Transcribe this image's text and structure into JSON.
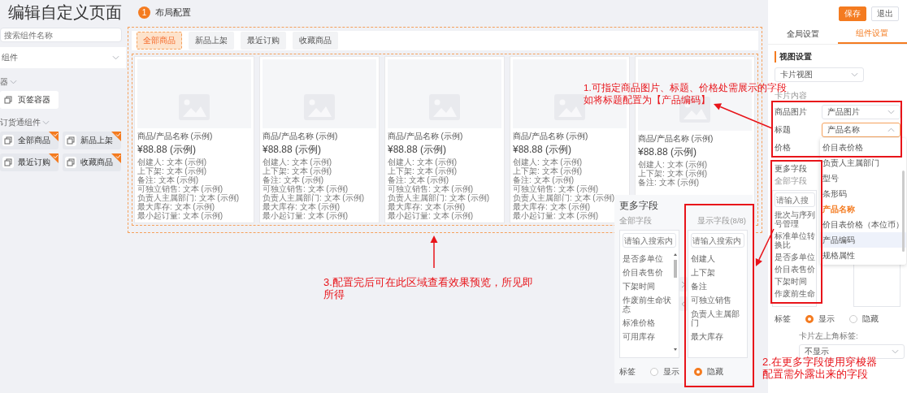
{
  "header": {
    "title": "编辑自定义页面",
    "step": {
      "number": "1",
      "label": "布局配置"
    }
  },
  "sidebar": {
    "search": {
      "placeholder": "搜索组件名称"
    },
    "panel_title": "组件",
    "groups": [
      {
        "title": "器",
        "items": [
          {
            "label": "页签容器",
            "added": false
          }
        ]
      },
      {
        "title": "订货通组件",
        "items": [
          {
            "label": "全部商品",
            "added": true
          },
          {
            "label": "新品上架",
            "added": true
          },
          {
            "label": "最近订购",
            "added": true
          },
          {
            "label": "收藏商品",
            "added": true
          }
        ]
      }
    ]
  },
  "preview": {
    "tabs": [
      {
        "label": "全部商品",
        "selected": true
      },
      {
        "label": "新品上架",
        "selected": false
      },
      {
        "label": "最近订购",
        "selected": false
      },
      {
        "label": "收藏商品",
        "selected": false
      }
    ],
    "cards": [
      {
        "title": "商品/产品名称 (示例)",
        "price": "¥88.88 (示例)",
        "fields": [
          "创建人: 文本 (示例)",
          "上下架: 文本 (示例)",
          "备注: 文本 (示例)",
          "可独立销售: 文本 (示例)",
          "负责人主属部门: 文本 (示例)",
          "最大库存: 文本 (示例)",
          "最小起订量: 文本 (示例)"
        ]
      },
      {
        "title": "商品/产品名称 (示例)",
        "price": "¥88.88 (示例)",
        "fields": [
          "创建人: 文本 (示例)",
          "上下架: 文本 (示例)",
          "备注: 文本 (示例)",
          "可独立销售: 文本 (示例)",
          "负责人主属部门: 文本 (示例)",
          "最大库存: 文本 (示例)",
          "最小起订量: 文本 (示例)"
        ]
      },
      {
        "title": "商品/产品名称 (示例)",
        "price": "¥88.88 (示例)",
        "fields": [
          "创建人: 文本 (示例)",
          "上下架: 文本 (示例)",
          "备注: 文本 (示例)",
          "可独立销售: 文本 (示例)",
          "负责人主属部门: 文本 (示例)",
          "最大库存: 文本 (示例)",
          "最小起订量: 文本 (示例)"
        ]
      },
      {
        "title": "商品/产品名称 (示例)",
        "price": "¥88.88 (示例)",
        "fields": [
          "创建人: 文本 (示例)",
          "上下架: 文本 (示例)",
          "备注: 文本 (示例)",
          "可独立销售: 文本 (示例)",
          "负责人主属部门: 文本 (示例)",
          "最大库存: 文本 (示例)",
          "最小起订量: 文本 (示例)"
        ]
      },
      {
        "title": "商品/产品名称 (示例)",
        "price": "¥88.88 (示例)",
        "fields": [
          "创建人: 文本 (示例)",
          "上下架: 文本 (示例)",
          "备注: 文本 (示例)"
        ]
      }
    ]
  },
  "field_picker": {
    "title": "更多字段",
    "source_label": "全部字段",
    "target_label": "显示字段(8/8)",
    "source": {
      "placeholder": "请输入搜索内",
      "items": [
        "是否多单位",
        "价目表售价",
        "下架时间",
        "作废前生命状态",
        "标准价格",
        "可用库存"
      ]
    },
    "target": {
      "placeholder": "请输入搜索内",
      "items": [
        "创建人",
        "上下架",
        "备注",
        "可独立销售",
        "负责人主属部门",
        "最大库存"
      ]
    },
    "tag": {
      "label": "标签",
      "options": [
        {
          "label": "显示",
          "selected": false
        },
        {
          "label": "隐藏",
          "selected": true
        }
      ]
    }
  },
  "settings": {
    "buttons": [
      {
        "label": "保存",
        "kind": "primary"
      },
      {
        "label": "退出",
        "kind": "default"
      }
    ],
    "tabs": [
      {
        "label": "全局设置",
        "selected": false
      },
      {
        "label": "组件设置",
        "selected": true
      }
    ],
    "section_title": "视图设置",
    "view": "卡片视图",
    "content_label": "卡片内容",
    "rows": [
      {
        "label": "商品图片",
        "value": "产品图片",
        "open": false
      },
      {
        "label": "标题",
        "value": "产品名称",
        "open": true
      },
      {
        "label": "价格"
      }
    ],
    "dropdown": [
      {
        "label": "价目表价格",
        "selected": false,
        "highlighted": false
      },
      {
        "label": "负责人主属部门",
        "selected": false,
        "highlighted": false
      },
      {
        "label": "型号",
        "selected": false,
        "highlighted": false
      },
      {
        "label": "条形码",
        "selected": false,
        "highlighted": false
      },
      {
        "label": "产品名称",
        "selected": true,
        "highlighted": false
      },
      {
        "label": "价目表价格（本位币）",
        "selected": false,
        "highlighted": false
      },
      {
        "label": "产品编码",
        "selected": false,
        "highlighted": true
      },
      {
        "label": "规格属性",
        "selected": false,
        "highlighted": false
      }
    ],
    "more_fields": {
      "title": "更多字段",
      "source_label": "全部字段",
      "placeholder": "请输入搜",
      "items": [
        "批次与序列号管理",
        "标准单位转换比",
        "是否多单位",
        "价目表售价",
        "下架时间",
        "作废前生命"
      ]
    },
    "tag": {
      "label": "标签",
      "options": [
        {
          "label": "显示",
          "selected": true
        },
        {
          "label": "隐藏",
          "selected": false
        }
      ]
    },
    "corner_label": "卡片左上角标签:",
    "corner_value": "不显示"
  },
  "annotations": [
    {
      "lines": [
        "1.可指定商品图片、标题、价格处需展示的字段",
        "如将标题配置为【产品编码】"
      ]
    },
    {
      "lines": [
        "2.在更多字段使用穿梭器",
        "配置需外露出来的字段"
      ]
    },
    {
      "lines": [
        "3.配置完后可在此区域查看效果预览，所见即",
        "所得"
      ]
    }
  ]
}
